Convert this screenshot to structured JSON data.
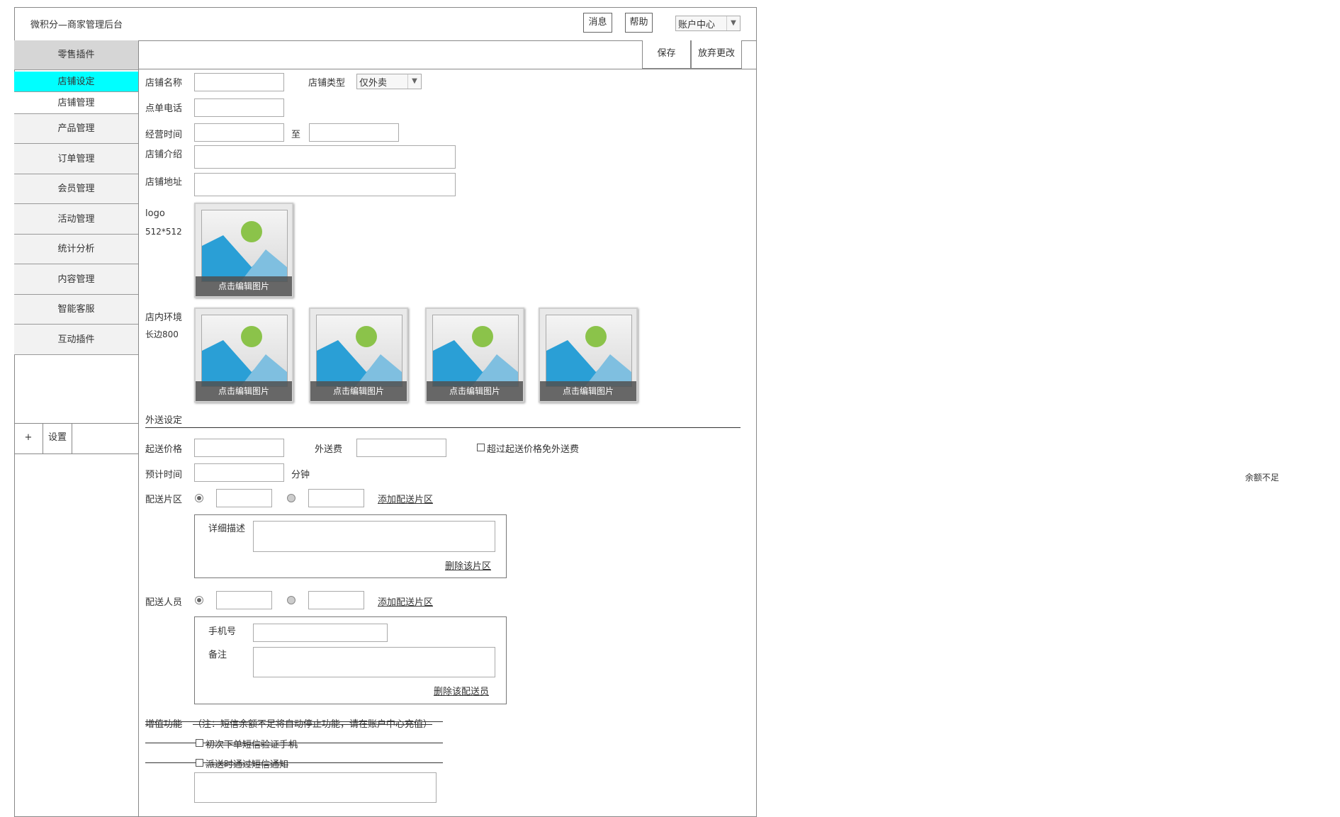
{
  "header": {
    "title": "微积分—商家管理后台",
    "messages_label": "消息",
    "help_label": "帮助",
    "account_select_value": "账户中心"
  },
  "toolbar": {
    "save_label": "保存",
    "discard_label": "放弃更改"
  },
  "sidebar": {
    "group_label": "零售插件",
    "items": [
      {
        "label": "店铺设定"
      },
      {
        "label": "店铺管理"
      },
      {
        "label": "产品管理"
      },
      {
        "label": "订单管理"
      },
      {
        "label": "会员管理"
      },
      {
        "label": "活动管理"
      },
      {
        "label": "统计分析"
      },
      {
        "label": "内容管理"
      },
      {
        "label": "智能客服"
      },
      {
        "label": "互动插件"
      }
    ],
    "add_label": "+",
    "settings_label": "设置"
  },
  "form": {
    "shop_name_label": "店铺名称",
    "shop_type_label": "店铺类型",
    "shop_type_value": "仅外卖",
    "order_phone_label": "点单电话",
    "hours_label": "经营时间",
    "hours_to": "至",
    "intro_label": "店铺介绍",
    "address_label": "店铺地址",
    "logo_label": "logo",
    "logo_size": "512*512",
    "edit_image_label": "点击编辑图片",
    "env_label": "店内环境",
    "env_size": "长边800"
  },
  "delivery": {
    "section_title": "外送设定",
    "min_price_label": "起送价格",
    "fee_label": "外送费",
    "free_fee_checkbox": "超过起送价格免外送费",
    "eta_label": "预计时间",
    "eta_unit": "分钟",
    "zone_label": "配送片区",
    "add_zone_link": "添加配送片区",
    "zone_detail_label": "详细描述",
    "delete_zone_link": "删除该片区",
    "staff_label": "配送人员",
    "add_staff_link": "添加配送片区",
    "phone_label": "手机号",
    "note_label": "备注",
    "delete_staff_link": "删除该配送员"
  },
  "value_added": {
    "title": "增值功能",
    "note": "（注：短信余额不足将自动停止功能，请在账户中心充值）",
    "opt1": "初次下单短信验证手机",
    "opt2": "派送时通过短信通知"
  },
  "side_note": "余额不足",
  "colors": {
    "active_item": "#00ffff",
    "border": "#999999"
  }
}
